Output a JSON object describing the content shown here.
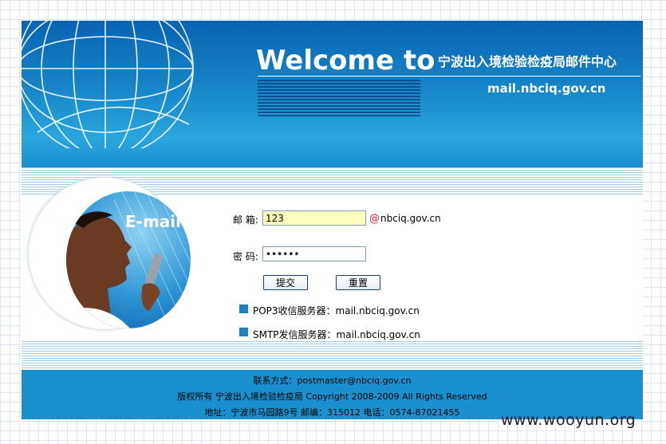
{
  "banner": {
    "welcome": "Welcome to",
    "org_name": "宁波出入境检验检疫局邮件中心",
    "domain": "mail.nbciq.gov.cn"
  },
  "photo": {
    "label": "E-mail"
  },
  "login": {
    "email_label": "邮 箱:",
    "email_value": "123",
    "at": "@",
    "mail_domain": "nbciq.gov.cn",
    "password_label": "密 码:",
    "password_value": "123456",
    "submit_label": "提交",
    "reset_label": "重置"
  },
  "servers": [
    {
      "label": "POP3收信服务器：mail.nbciq.gov.cn"
    },
    {
      "label": "SMTP发信服务器：mail.nbciq.gov.cn"
    }
  ],
  "footer": {
    "contact": "联系方式：postmaster@nbciq.gov.cn",
    "copyright": "版权所有 宁波出入境检验检疫局 Copyright 2008-2009 All Rights Reserved",
    "address": "地址：宁波市马园路9号 邮编：315012 电话：0574-87021455"
  },
  "watermark": "www.wooyun.org",
  "colors": {
    "banner_blue": "#1684c7",
    "footer_blue": "#1b90ce",
    "at_red": "#e0242c",
    "bullet_blue": "#1f7fbf"
  }
}
